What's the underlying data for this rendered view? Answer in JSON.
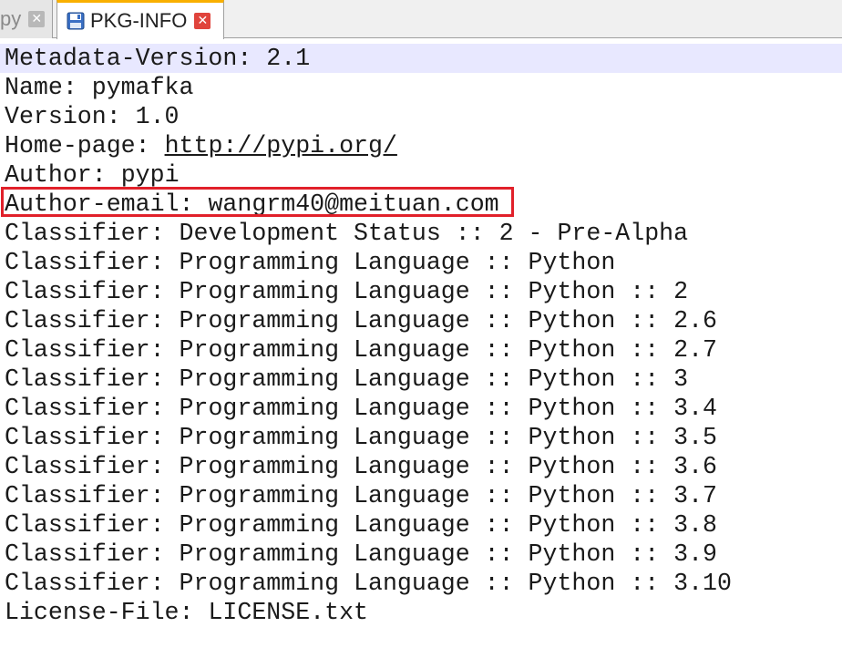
{
  "tabs": [
    {
      "label": "py",
      "active": false
    },
    {
      "label": "PKG-INFO",
      "active": true
    }
  ],
  "icons": {
    "close": "close-icon",
    "save": "save-icon"
  },
  "colors": {
    "active_tab_accent": "#f9b000",
    "close_active": "#e0443c",
    "current_line": "#e8e8ff",
    "highlight_box": "#e1202a"
  },
  "editor": {
    "lines": [
      {
        "key": "Metadata-Version:",
        "value": "2.1"
      },
      {
        "key": "Name:",
        "value": "pymafka"
      },
      {
        "key": "Version:",
        "value": "1.0"
      },
      {
        "key": "Home-page:",
        "value": "http://pypi.org/"
      },
      {
        "key": "Author:",
        "value": "pypi"
      },
      {
        "key": "Author-email:",
        "value": "wangrm40@meituan.com"
      },
      {
        "key": "Classifier:",
        "value": "Development Status :: 2 - Pre-Alpha"
      },
      {
        "key": "Classifier:",
        "value": "Programming Language :: Python"
      },
      {
        "key": "Classifier:",
        "value": "Programming Language :: Python :: 2"
      },
      {
        "key": "Classifier:",
        "value": "Programming Language :: Python :: 2.6"
      },
      {
        "key": "Classifier:",
        "value": "Programming Language :: Python :: 2.7"
      },
      {
        "key": "Classifier:",
        "value": "Programming Language :: Python :: 3"
      },
      {
        "key": "Classifier:",
        "value": "Programming Language :: Python :: 3.4"
      },
      {
        "key": "Classifier:",
        "value": "Programming Language :: Python :: 3.5"
      },
      {
        "key": "Classifier:",
        "value": "Programming Language :: Python :: 3.6"
      },
      {
        "key": "Classifier:",
        "value": "Programming Language :: Python :: 3.7"
      },
      {
        "key": "Classifier:",
        "value": "Programming Language :: Python :: 3.8"
      },
      {
        "key": "Classifier:",
        "value": "Programming Language :: Python :: 3.9"
      },
      {
        "key": "Classifier:",
        "value": "Programming Language :: Python :: 3.10"
      },
      {
        "key": "License-File:",
        "value": "LICENSE.txt"
      }
    ]
  }
}
